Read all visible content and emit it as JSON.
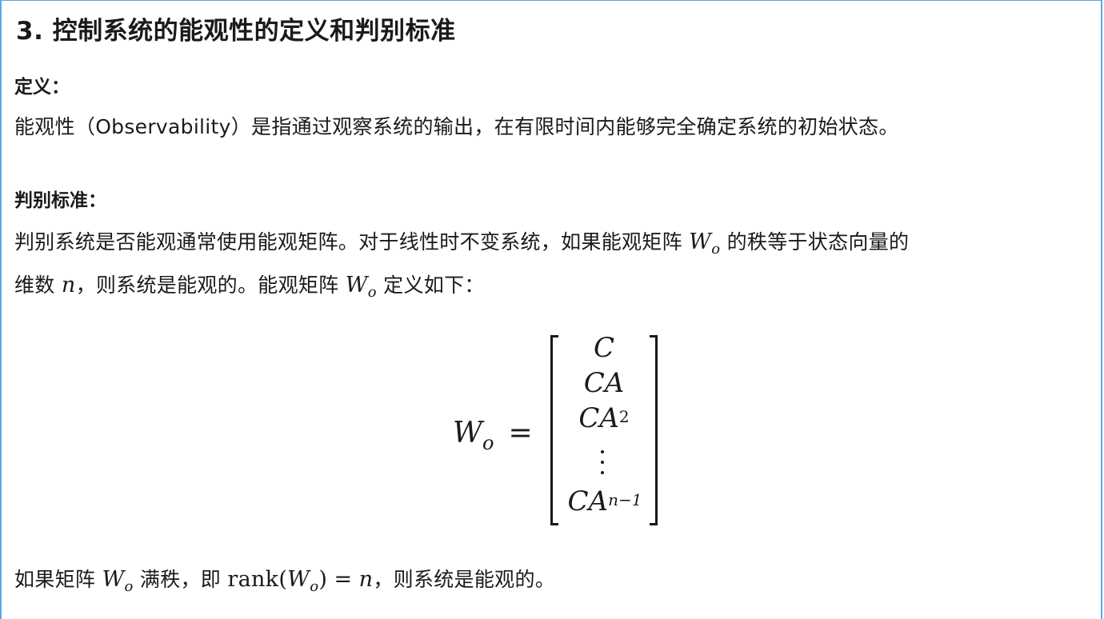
{
  "heading": "3. 控制系统的能观性的定义和判别标准",
  "definition": {
    "label": "定义：",
    "text": "能观性（Observability）是指通过观察系统的输出，在有限时间内能够完全确定系统的初始状态。"
  },
  "criterion": {
    "label": "判别标准：",
    "line1_a": "判别系统是否能观通常使用能观矩阵。对于线性时不变系统，如果能观矩阵",
    "line1_b": "的秩等于状态向量的",
    "line2_a": "维数",
    "line2_b": "，则系统是能观的。能观矩阵",
    "line2_c": "定义如下："
  },
  "math": {
    "W": "W",
    "o": "o",
    "n": "n",
    "equals": "=",
    "rank": "rank",
    "matrix_rows": [
      "C",
      "CA",
      "CA",
      "⋮",
      "CA"
    ],
    "exp_2": "2",
    "exp_n1": "n−1"
  },
  "conclusion": {
    "a": "如果矩阵",
    "b": "满秩，即",
    "c": "，则系统是能观的。"
  }
}
